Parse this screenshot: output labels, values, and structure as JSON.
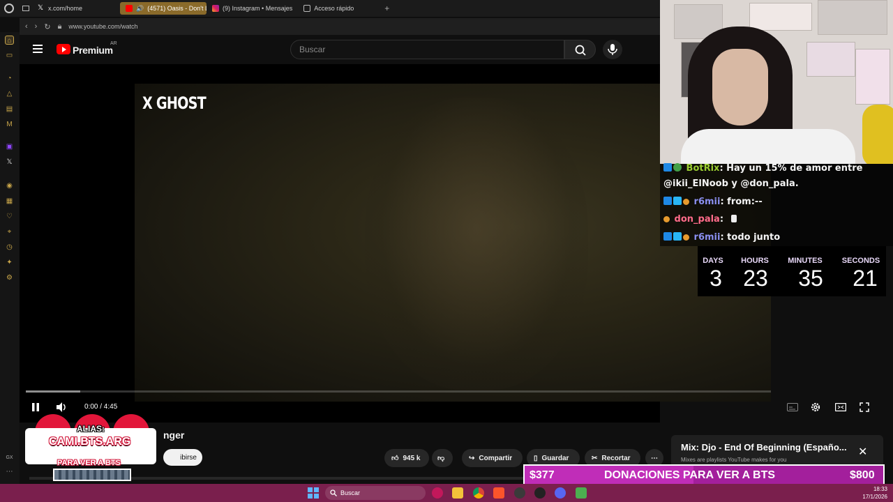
{
  "browser": {
    "tabs": [
      {
        "label": "x.com/home"
      },
      {
        "label": "(4571) Oasis - Don't L"
      },
      {
        "label": "(9) Instagram • Mensajes"
      },
      {
        "label": "Acceso rápido"
      }
    ],
    "url": "www.youtube.com/watch"
  },
  "youtube": {
    "brand": "Premium",
    "region": "AR",
    "search_placeholder": "Buscar",
    "video_overlay_text": "X GHOST",
    "time": "0:00 / 4:45",
    "title_fragment": "nger",
    "subscribe_label": "ibirse",
    "likes": "945 k",
    "share_label": "Compartir",
    "save_label": "Guardar",
    "clip_label": "Recortar",
    "progress_loaded_fraction": 0.073
  },
  "alias_overlay": {
    "title": "ALIAS:",
    "handle": "CAMI.BTS.ARG",
    "subtitle": "PARA VER A BTS"
  },
  "chat": {
    "messages": [
      {
        "user": "BotRix",
        "user_color": "#9acd32",
        "text": ": Hay un 15% de amor entre"
      },
      {
        "user": "",
        "user_color": "#ffffff",
        "text": "@ikii_ElNoob y @don_pala."
      },
      {
        "user": "r6mii",
        "user_color": "#8a8ff0",
        "text": ": from:--"
      },
      {
        "user": "don_pala",
        "user_color": "#ff6b8a",
        "text": ":"
      },
      {
        "user": "r6mii",
        "user_color": "#8a8ff0",
        "text": ": todo junto"
      }
    ]
  },
  "countdown": {
    "labels": [
      "DAYS",
      "HOURS",
      "MINUTES",
      "SECONDS"
    ],
    "values": [
      "3",
      "23",
      "35",
      "21"
    ]
  },
  "miniplayer": {
    "title": "Mix: Djo - End Of Beginning (Españo...",
    "subtitle": "Mixes are playlists YouTube makes for you"
  },
  "donation": {
    "current": "$377",
    "label": "DONACIONES PARA VER A BTS",
    "goal": "$800",
    "progress_fraction": 0.47
  },
  "taskbar": {
    "search_label": "Buscar",
    "time": "18:33",
    "date": "17/1/2026"
  },
  "colors": {
    "yt_red": "#ff0000",
    "active_tab": "#8a6a2a",
    "donation_bar": "#a31f9c",
    "taskbar": "#7a1f4d",
    "opera_accent": "#c9a64a"
  }
}
